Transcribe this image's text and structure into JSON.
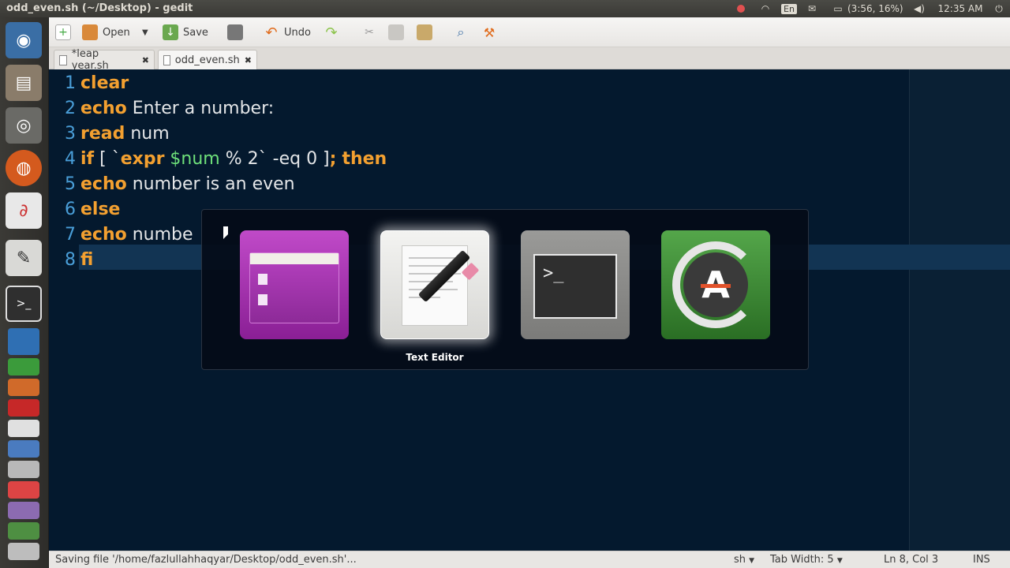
{
  "window": {
    "title": "odd_even.sh (~/Desktop) - gedit"
  },
  "panel": {
    "keyboard_layout": "En",
    "battery": "(3:56, 16%)",
    "clock": "12:35 AM",
    "icons": [
      "record-icon",
      "wifi-icon",
      "mail-icon",
      "battery-icon",
      "volume-icon",
      "power-icon"
    ]
  },
  "launcher": {
    "items": [
      "ubuntu-dash-icon",
      "files-icon",
      "audio-player-icon",
      "firefox-icon",
      "pdf-reader-icon",
      "text-editor-icon",
      "terminal-icon",
      "writer-icon",
      "calc-icon",
      "impress-icon",
      "youtube-icon",
      "app-icon",
      "app-icon",
      "gmail-icon",
      "app-icon",
      "app-icon",
      "app-icon"
    ]
  },
  "toolbar": {
    "new_icon": "new-document-icon",
    "open_label": "Open",
    "save_label": "Save",
    "undo_label": "Undo",
    "print_icon": "print-icon",
    "redo_icon": "redo-icon",
    "cut_icon": "cut-icon",
    "copy_icon": "copy-icon",
    "paste_icon": "paste-icon",
    "search_icon": "search-icon",
    "replace_icon": "replace-icon"
  },
  "tabs": [
    {
      "label": "*leap year.sh",
      "active": false
    },
    {
      "label": "odd_even.sh",
      "active": true
    }
  ],
  "editor": {
    "lines": [
      {
        "num": "1",
        "kw": "clear",
        "rest": ""
      },
      {
        "num": "2",
        "kw": "echo",
        "rest": " Enter a number:"
      },
      {
        "num": "3",
        "kw": "read",
        "rest": " num"
      },
      {
        "num": "4",
        "kw": "if",
        "rest": " [ `expr $num % 2` -eq 0 ]; then"
      },
      {
        "num": "5",
        "kw": "echo",
        "rest": " number is an even"
      },
      {
        "num": "6",
        "kw": "else",
        "rest": ""
      },
      {
        "num": "7",
        "kw": "echo",
        "rest": " numbe"
      },
      {
        "num": "8",
        "kw": "fi",
        "rest": ""
      }
    ]
  },
  "switcher": {
    "apps": [
      "files-icon",
      "text-editor-icon",
      "terminal-icon",
      "software-updater-icon"
    ],
    "selected_label": "Text Editor"
  },
  "statusbar": {
    "message": "Saving file '/home/fazlullahhaqyar/Desktop/odd_even.sh'...",
    "language": "sh",
    "tab_width": "Tab Width: 5",
    "position": "Ln 8, Col 3",
    "mode": "INS"
  },
  "colors": {
    "editor_bg": "#04192e",
    "keyword": "#f3a030",
    "variable": "#6ee07a",
    "line_number": "#4a9fd9"
  }
}
